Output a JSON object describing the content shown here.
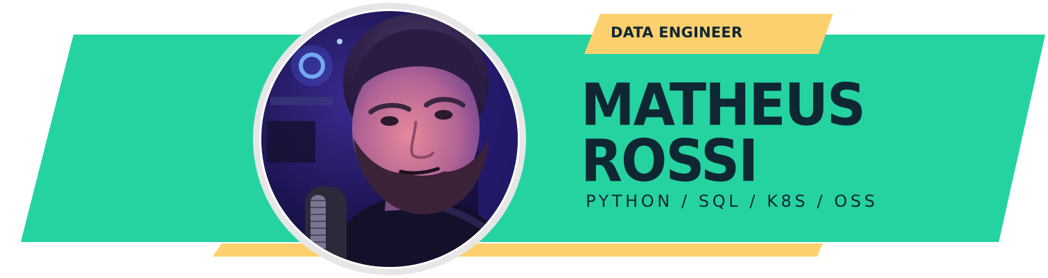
{
  "colors": {
    "banner_green": "#25d3a1",
    "accent_yellow": "#fdd06e",
    "text_navy": "#0f2733",
    "avatar_ring": "#e6e6e6"
  },
  "profile": {
    "role": "DATA ENGINEER",
    "first_name": "MATHEUS",
    "last_name": "ROSSI",
    "skills": "PYTHON / SQL / K8S / OSS"
  },
  "avatar": {
    "icon": "person-portrait-photo"
  }
}
